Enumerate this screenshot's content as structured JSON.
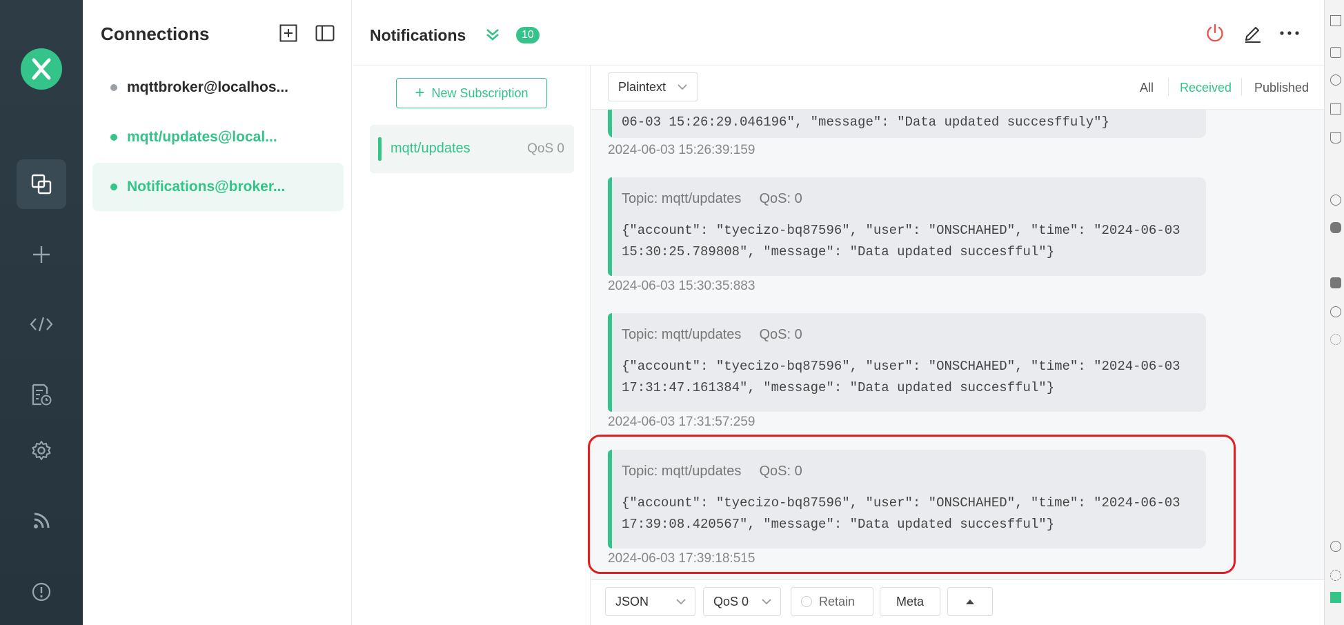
{
  "sidebar_nav": {
    "logo": "mqttx-logo-icon",
    "items": [
      {
        "icon": "connections-icon",
        "active": true
      },
      {
        "icon": "plus-icon"
      },
      {
        "icon": "code-icon"
      },
      {
        "icon": "log-icon"
      },
      {
        "icon": "gear-icon"
      },
      {
        "icon": "rss-icon"
      },
      {
        "icon": "info-icon"
      }
    ]
  },
  "connections": {
    "title": "Connections",
    "items": [
      {
        "label": "mqttbroker@localhos...",
        "status_color": "#9aa0a6",
        "selected": false
      },
      {
        "label": "mqtt/updates@local...",
        "status_color": "#34c388",
        "selected": false
      },
      {
        "label": "Notifications@broker...",
        "status_color": "#34c388",
        "selected": true
      }
    ]
  },
  "header": {
    "title": "Notifications",
    "unread_count": "10"
  },
  "subscriptions": {
    "new_button": "New Subscription",
    "items": [
      {
        "topic": "mqtt/updates",
        "qos": "QoS 0"
      }
    ]
  },
  "messages_toolbar": {
    "format": "Plaintext",
    "filters": [
      "All",
      "Received",
      "Published"
    ],
    "selected_filter": "Received"
  },
  "messages": {
    "partial_top_payload": "06-03 15:26:29.046196\", \"message\": \"Data updated succesffuly\"}",
    "partial_top_time": "2024-06-03 15:26:39:159",
    "items": [
      {
        "topic": "Topic: mqtt/updates",
        "qos": "QoS: 0",
        "payload": "{\"account\": \"tyecizo-bq87596\", \"user\": \"ONSCHAHED\", \"time\": \"2024-06-03 15:30:25.789808\", \"message\": \"Data updated succesfful\"}",
        "time": "2024-06-03 15:30:35:883"
      },
      {
        "topic": "Topic: mqtt/updates",
        "qos": "QoS: 0",
        "payload": "{\"account\": \"tyecizo-bq87596\", \"user\": \"ONSCHAHED\", \"time\": \"2024-06-03 17:31:47.161384\", \"message\": \"Data updated succesfful\"}",
        "time": "2024-06-03 17:31:57:259"
      },
      {
        "topic": "Topic: mqtt/updates",
        "qos": "QoS: 0",
        "payload": "{\"account\": \"tyecizo-bq87596\", \"user\": \"ONSCHAHED\", \"time\": \"2024-06-03 17:39:08.420567\", \"message\": \"Data updated succesfful\"}",
        "time": "2024-06-03 17:39:18:515"
      }
    ]
  },
  "composer": {
    "format": "JSON",
    "qos": "QoS 0",
    "retain": "Retain",
    "meta": "Meta"
  },
  "colors": {
    "accent": "#34c388",
    "nav_bg": "#2e3c46",
    "highlight": "#e02020",
    "power": "#e5534b"
  }
}
